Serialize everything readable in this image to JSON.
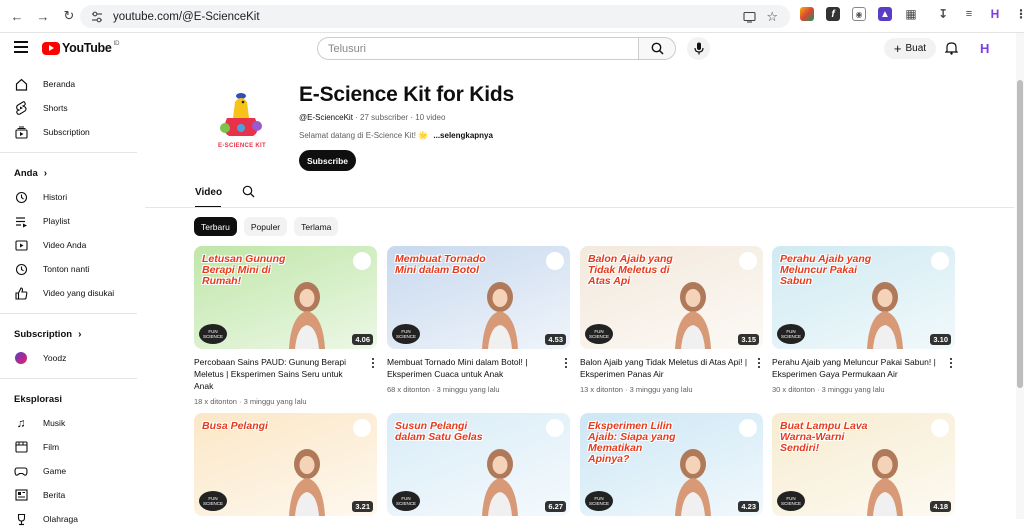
{
  "browser": {
    "url": "youtube.com/@E-ScienceKit"
  },
  "masthead": {
    "logo_text": "YouTube",
    "logo_region": "ID",
    "search_placeholder": "Telusuri",
    "create_label": "Buat"
  },
  "sidebar": {
    "main": [
      {
        "label": "Beranda",
        "icon": "home-icon"
      },
      {
        "label": "Shorts",
        "icon": "shorts-icon"
      },
      {
        "label": "Subscription",
        "icon": "subscriptions-icon"
      }
    ],
    "you_heading": "Anda",
    "you": [
      {
        "label": "Histori",
        "icon": "history-icon"
      },
      {
        "label": "Playlist",
        "icon": "playlist-icon"
      },
      {
        "label": "Video Anda",
        "icon": "your-videos-icon"
      },
      {
        "label": "Tonton nanti",
        "icon": "watch-later-icon"
      },
      {
        "label": "Video yang disukai",
        "icon": "liked-icon"
      }
    ],
    "subscription_heading": "Subscription",
    "subscriptions": [
      {
        "label": "Yoodz"
      }
    ],
    "explore_heading": "Eksplorasi",
    "explore": [
      {
        "label": "Musik",
        "icon": "music-icon"
      },
      {
        "label": "Film",
        "icon": "film-icon"
      },
      {
        "label": "Game",
        "icon": "gaming-icon"
      },
      {
        "label": "Berita",
        "icon": "news-icon"
      },
      {
        "label": "Olahraga",
        "icon": "trophy-icon"
      }
    ]
  },
  "channel": {
    "name": "E-Science Kit for Kids",
    "handle": "@E-ScienceKit",
    "subscribers": "27 subscriber",
    "videos": "10 video",
    "description": "Selamat datang di E-Science Kit! 🌟",
    "more_label": "...selengkapnya",
    "subscribe_label": "Subscribe",
    "avatar_caption": "E-SCIENCE KIT"
  },
  "tabs": {
    "video_label": "Video"
  },
  "chips": [
    "Terbaru",
    "Populer",
    "Terlama"
  ],
  "videos": [
    {
      "title": "Percobaan Sains PAUD: Gunung Berapi Meletus | Eksperimen Sains Seru untuk Anak",
      "views": "18 x ditonton",
      "age": "3 minggu yang lalu",
      "duration": "4.06",
      "thumb_text": "Letusan Gunung Berapi Mini di Rumah!",
      "bg": "#bfe6a8"
    },
    {
      "title": "Membuat Tornado Mini dalam Botol! | Eksperimen Cuaca untuk Anak",
      "views": "68 x ditonton",
      "age": "3 minggu yang lalu",
      "duration": "4.53",
      "thumb_text": "Membuat Tornado Mini dalam Botol",
      "bg": "#c8d9ee"
    },
    {
      "title": "Balon Ajaib yang Tidak Meletus di Atas Api! | Eksperimen Panas Air",
      "views": "13 x ditonton",
      "age": "3 minggu yang lalu",
      "duration": "3.15",
      "thumb_text": "Balon Ajaib yang Tidak Meletus di Atas Api",
      "bg": "#f3e9dc"
    },
    {
      "title": "Perahu Ajaib yang Meluncur Pakai Sabun! | Eksperimen Gaya Permukaan Air",
      "views": "30 x ditonton",
      "age": "3 minggu yang lalu",
      "duration": "3.10",
      "thumb_text": "Perahu Ajaib yang Meluncur Pakai Sabun",
      "bg": "#cfeaf2"
    },
    {
      "title": "",
      "views": "",
      "age": "",
      "duration": "3.21",
      "thumb_text": "Busa Pelangi",
      "bg": "#fbe7c6"
    },
    {
      "title": "",
      "views": "",
      "age": "",
      "duration": "6.27",
      "thumb_text": "Susun Pelangi dalam Satu Gelas",
      "bg": "#d9ecf7"
    },
    {
      "title": "",
      "views": "",
      "age": "",
      "duration": "4.23",
      "thumb_text": "Eksperimen Lilin Ajaib: Siapa yang Mematikan Apinya?",
      "bg": "#cde7f5"
    },
    {
      "title": "",
      "views": "",
      "age": "",
      "duration": "4.18",
      "thumb_text": "Buat Lampu Lava Warna-Warni Sendiri!",
      "bg": "#f7ecd0"
    }
  ]
}
